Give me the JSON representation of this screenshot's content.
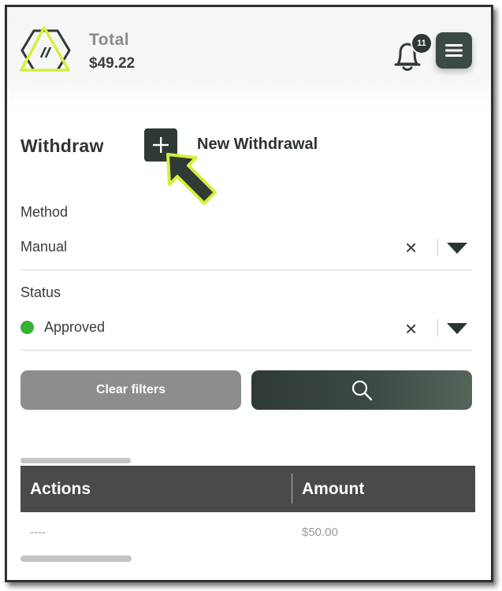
{
  "header": {
    "total_title": "Total",
    "total_amount": "$49.22",
    "notification_count": "11",
    "logo_icon": "logo-hexagon-triangle-icon",
    "bell_icon": "bell-icon",
    "menu_icon": "hamburger-menu-icon"
  },
  "withdraw": {
    "title": "Withdraw",
    "add_button_symbol": "+",
    "new_withdrawal_label": "New Withdrawal",
    "annotation_icon": "pointer-arrow-icon"
  },
  "filters": {
    "method": {
      "label": "Method",
      "value": "Manual",
      "clear_symbol": "×"
    },
    "status": {
      "label": "Status",
      "value": "Approved",
      "clear_symbol": "×",
      "indicator_color": "#34b233"
    }
  },
  "actions": {
    "clear_filters_label": "Clear filters",
    "search_icon": "search-icon"
  },
  "table": {
    "columns": [
      "Actions",
      "Amount"
    ],
    "rows": [
      {
        "actions": "----",
        "amount": "$50.00"
      }
    ]
  },
  "colors": {
    "brand_dark": "#2f3a34",
    "accent_lime": "#d7ee3c",
    "table_header": "#4a4a4a",
    "clear_button": "#8d8d8d"
  }
}
